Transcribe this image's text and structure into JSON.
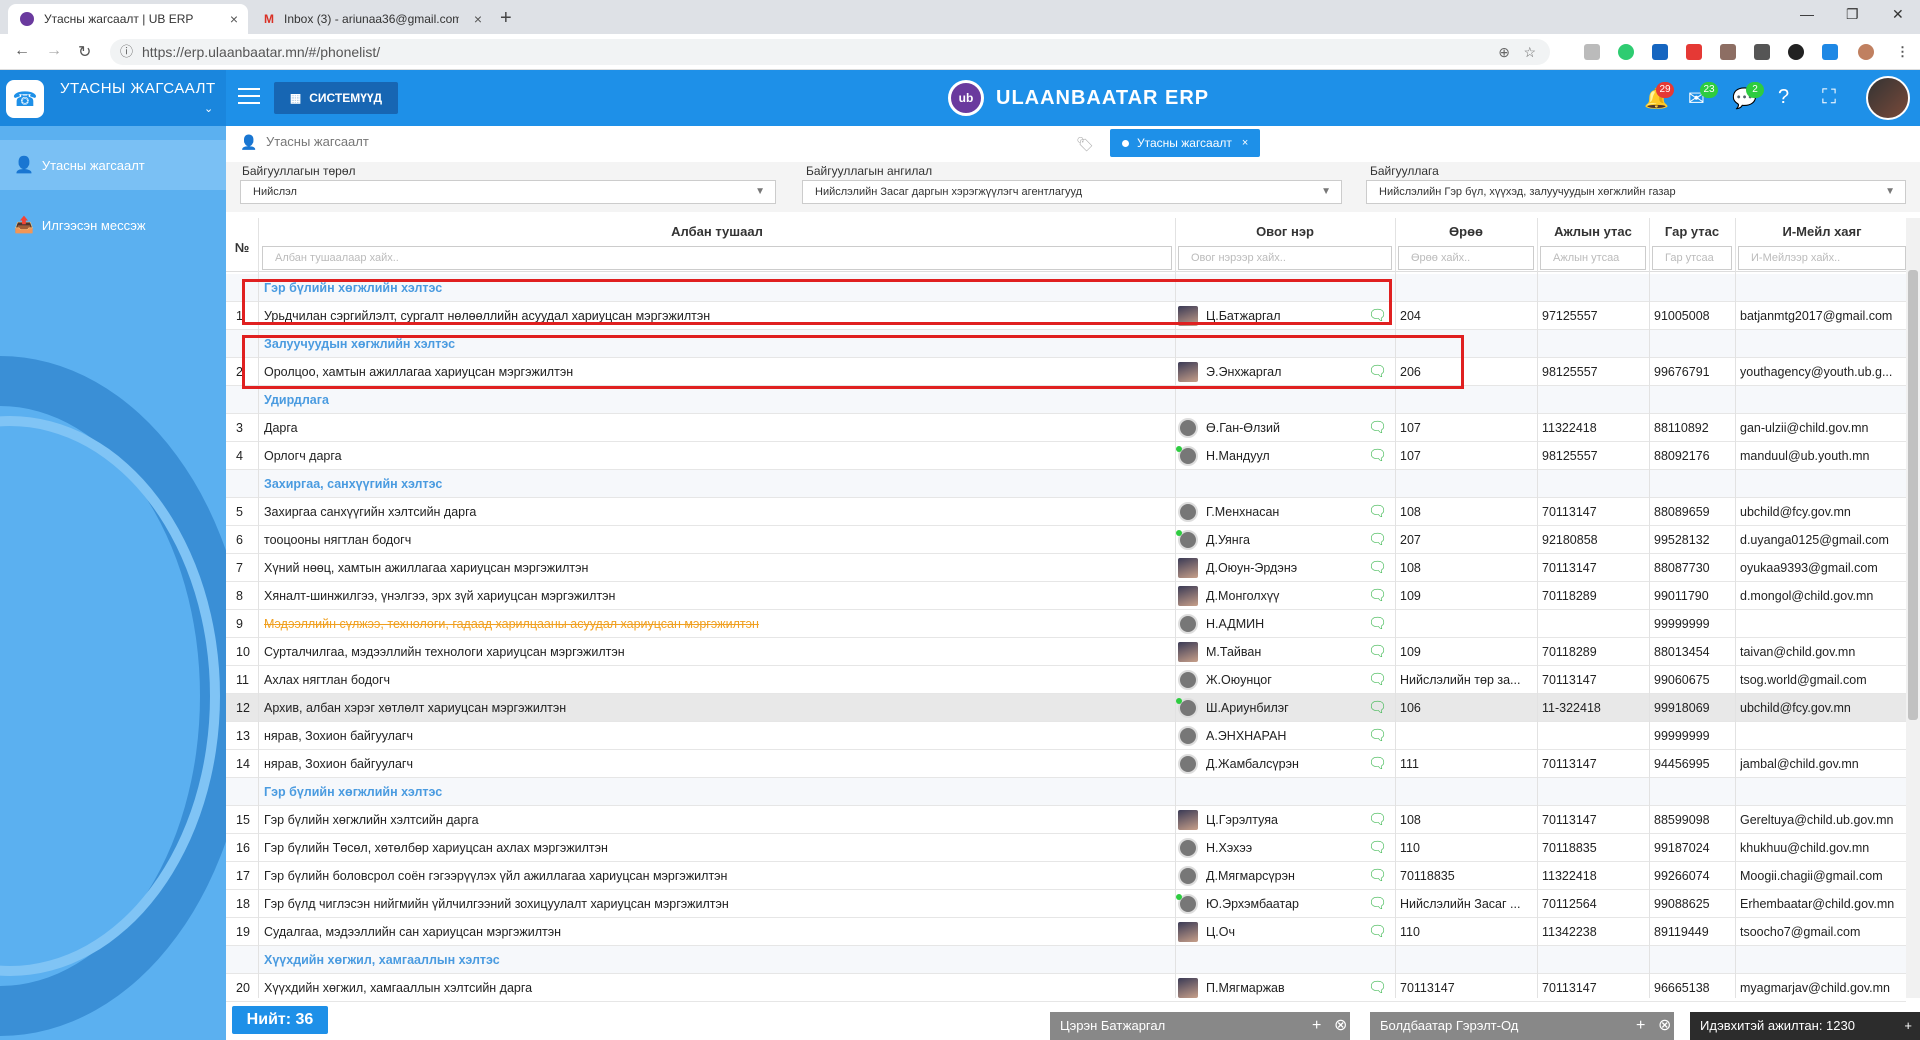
{
  "browser": {
    "tabs": [
      {
        "title": "Утасны жагсаалт | UB ERP",
        "active": true
      },
      {
        "title": "Inbox (3) - ariunaa36@gmail.com",
        "active": false
      }
    ],
    "url": "https://erp.ulaanbaatar.mn/#/phonelist/"
  },
  "header": {
    "module_title": "УТАСНЫ ЖАГСААЛТ",
    "system_button": "СИСТЕМҮҮД",
    "brand_logo": "ub",
    "brand_name": "ULAANBAATAR ERP",
    "badges": {
      "notifications": "29",
      "mail": "23",
      "messages": "2"
    }
  },
  "sidebar": {
    "items": [
      {
        "label": "Утасны жагсаалт",
        "icon": "contact-icon"
      },
      {
        "label": "Илгээсэн мессэж",
        "icon": "inbox-icon"
      }
    ]
  },
  "breadcrumb": "Утасны жагсаалт",
  "active_tab_chip": "Утасны жагсаалт",
  "filters": {
    "type": {
      "label": "Байгууллагын төрөл",
      "value": "Нийслэл"
    },
    "category": {
      "label": "Байгууллагын ангилал",
      "value": "Нийслэлийн Засаг даргын хэрэгжүүлэгч агентлагууд"
    },
    "org": {
      "label": "Байгууллага",
      "value": "Нийслэлийн Гэр бүл, хүүхэд, залуучуудын хөгжлийн газар"
    }
  },
  "table": {
    "columns": {
      "no": "№",
      "position": "Албан тушаал",
      "name": "Овог нэр",
      "room": "Өрөө",
      "work_phone": "Ажлын утас",
      "mobile": "Гар утас",
      "email": "И-Мейл хаяг"
    },
    "placeholders": {
      "position": "Албан тушаалаар хайх..",
      "name": "Овог нэрээр хайх..",
      "room": "Өрөө хайх..",
      "work_phone": "Ажлын утсаа",
      "mobile": "Гар утсаа",
      "email": "И-Мейлээр хайх.."
    },
    "groups": [
      "Гэр бүлийн хөгжлийн хэлтэс",
      "Залуучуудын хөгжлийн хэлтэс",
      "Удирдлага",
      "Захиргаа, санхүүгийн хэлтэс",
      "Гэр бүлийн хөгжлийн хэлтэс",
      "Хүүхдийн хөгжил, хамгааллын хэлтэс"
    ],
    "rows": [
      {
        "no": "1",
        "position": "Урьдчилан сэргийлэлт, сургалт нөлөөллийн асуудал хариуцсан мэргэжилтэн",
        "name": "Ц.Батжаргал",
        "room": "204",
        "work": "97125557",
        "mobile": "91005008",
        "email": "batjanmtg2017@gmail.com"
      },
      {
        "no": "2",
        "position": "Оролцоо, хамтын ажиллагаа хариуцсан мэргэжилтэн",
        "name": "Э.Энхжаргал",
        "room": "206",
        "work": "98125557",
        "mobile": "99676791",
        "email": "youthagency@youth.ub.g..."
      },
      {
        "no": "3",
        "position": "Дарга",
        "name": "Ө.Ган-Өлзий",
        "room": "107",
        "work": "11322418",
        "mobile": "88110892",
        "email": "gan-ulzii@child.gov.mn"
      },
      {
        "no": "4",
        "position": "Орлогч дарга",
        "name": "Н.Мандуул",
        "room": "107",
        "work": "98125557",
        "mobile": "88092176",
        "email": "manduul@ub.youth.mn"
      },
      {
        "no": "5",
        "position": "Захиргаа санхүүгийн хэлтсийн дарга",
        "name": "Г.Менхнасан",
        "room": "108",
        "work": "70113147",
        "mobile": "88089659",
        "email": "ubchild@fcy.gov.mn"
      },
      {
        "no": "6",
        "position": "тооцооны нягтлан бодогч",
        "name": "Д.Уянга",
        "room": "207",
        "work": "92180858",
        "mobile": "99528132",
        "email": "d.uyanga0125@gmail.com"
      },
      {
        "no": "7",
        "position": "Хүний нөөц, хамтын ажиллагаа хариуцсан мэргэжилтэн",
        "name": "Д.Оюун-Эрдэнэ",
        "room": "108",
        "work": "70113147",
        "mobile": "88087730",
        "email": "oyukaa9393@gmail.com"
      },
      {
        "no": "8",
        "position": "Хяналт-шинжилгээ, үнэлгээ, эрх зүй хариуцсан мэргэжилтэн",
        "name": "Д.Монголхүү",
        "room": "109",
        "work": "70118289",
        "mobile": "99011790",
        "email": "d.mongol@child.gov.mn"
      },
      {
        "no": "9",
        "position": "Мэдээллийн сүлжээ, технологи, гадаад харилцааны асуудал хариуцсан мэргэжилтэн",
        "name": "Н.АДМИН",
        "room": "",
        "work": "",
        "mobile": "99999999",
        "email": ""
      },
      {
        "no": "10",
        "position": "Сурталчилгаа, мэдээллийн технологи хариуцсан мэргэжилтэн",
        "name": "М.Тайван",
        "room": "109",
        "work": "70118289",
        "mobile": "88013454",
        "email": "taivan@child.gov.mn"
      },
      {
        "no": "11",
        "position": "Ахлах нягтлан бодогч",
        "name": "Ж.Оюунцог",
        "room": "Нийслэлийн төр за...",
        "work": "70113147",
        "mobile": "99060675",
        "email": "tsog.world@gmail.com"
      },
      {
        "no": "12",
        "position": "Архив, албан хэрэг хөтлөлт хариуцсан мэргэжилтэн",
        "name": "Ш.Ариунбилэг",
        "room": "106",
        "work": "11-322418",
        "mobile": "99918069",
        "email": "ubchild@fcy.gov.mn"
      },
      {
        "no": "13",
        "position": "нярав, Зохион байгуулагч",
        "name": "А.ЭНХНАРАН",
        "room": "",
        "work": "",
        "mobile": "99999999",
        "email": ""
      },
      {
        "no": "14",
        "position": "нярав, Зохион байгуулагч",
        "name": "Д.Жамбалсүрэн",
        "room": "111",
        "work": "70113147",
        "mobile": "94456995",
        "email": "jambal@child.gov.mn"
      },
      {
        "no": "15",
        "position": "Гэр бүлийн хөгжлийн хэлтсийн дарга",
        "name": "Ц.Гэрэлтуяа",
        "room": "108",
        "work": "70113147",
        "mobile": "88599098",
        "email": "Gereltuya@child.ub.gov.mn"
      },
      {
        "no": "16",
        "position": "Гэр бүлийн Төсөл, хөтөлбөр хариуцсан ахлах мэргэжилтэн",
        "name": "Н.Хэхээ",
        "room": "110",
        "work": "70118835",
        "mobile": "99187024",
        "email": "khukhuu@child.gov.mn"
      },
      {
        "no": "17",
        "position": "Гэр бүлийн боловсрол соён гэгээрүүлэх үйл ажиллагаа хариуцсан мэргэжилтэн",
        "name": "Д.Мягмарсүрэн",
        "room": "70118835",
        "work": "11322418",
        "mobile": "99266074",
        "email": "Moogii.chagii@gmail.com"
      },
      {
        "no": "18",
        "position": "Гэр бүлд чиглэсэн нийгмийн үйлчилгээний зохицуулалт хариуцсан мэргэжилтэн",
        "name": "Ю.Эрхэмбаатар",
        "room": "Нийслэлийн Засаг ...",
        "work": "70112564",
        "mobile": "99088625",
        "email": "Erhembaatar@child.gov.mn"
      },
      {
        "no": "19",
        "position": "Судалгаа, мэдээллийн сан хариуцсан мэргэжилтэн",
        "name": "Ц.Оч",
        "room": "110",
        "work": "11342238",
        "mobile": "89119449",
        "email": "tsoocho7@gmail.com"
      },
      {
        "no": "20",
        "position": "Хүүхдийн хөгжил, хамгааллын хэлтсийн дарга",
        "name": "П.Мягмаржав",
        "room": "70113147",
        "work": "70113147",
        "mobile": "96665138",
        "email": "myagmarjav@child.gov.mn"
      }
    ]
  },
  "footer": {
    "total": "Нийт: 36",
    "chat_windows": [
      "Цэрэн Батжаргал",
      "Болдбаатар Гэрэлт-Од"
    ],
    "online_users": "Идэвхитэй ажилтан: 1230"
  }
}
